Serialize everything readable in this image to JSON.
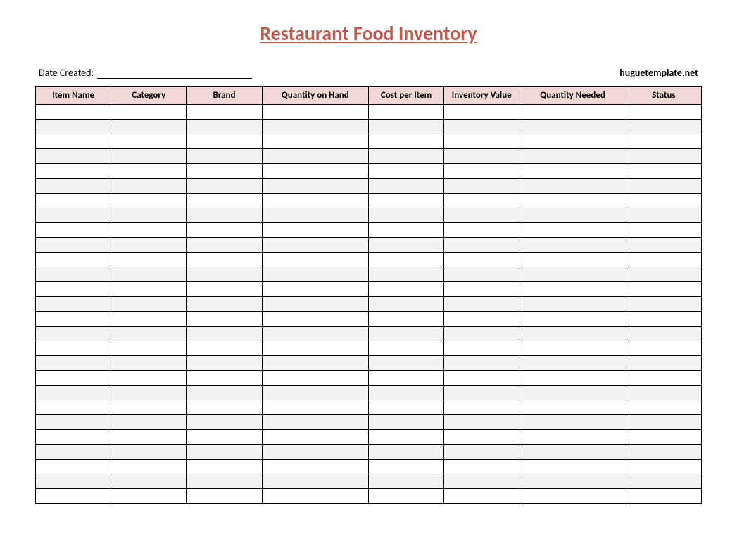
{
  "title": "Restaurant Food Inventory",
  "meta": {
    "date_created_label": "Date Created:",
    "date_created_value": "",
    "attribution": "huguetemplate.net"
  },
  "table": {
    "headers": [
      "Item Name",
      "Category",
      "Brand",
      "Quantity on Hand",
      "Cost per Item",
      "Inventory Value",
      "Quantity Needed",
      "Status"
    ],
    "sections": [
      {
        "row_count": 6
      },
      {
        "row_count": 9
      },
      {
        "row_count": 8
      },
      {
        "row_count": 4
      }
    ]
  }
}
